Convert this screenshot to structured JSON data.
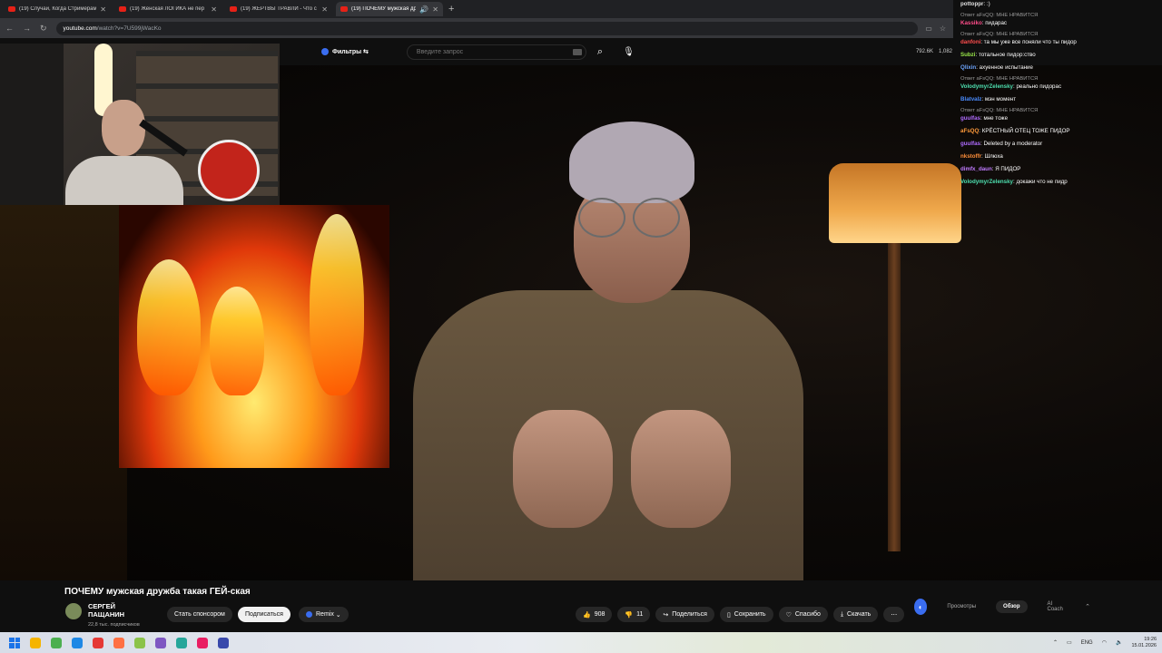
{
  "browser": {
    "tabs": [
      {
        "title": "(19) Случаи, Когда Стримерам",
        "active": false
      },
      {
        "title": "(19) Женская ЛОГИКА не пер",
        "active": false
      },
      {
        "title": "(19) ЖЕРТВЫ ТРАВЛИ - Что с",
        "active": false
      },
      {
        "title": "(19) ПОЧЕМУ мужская др",
        "active": true
      }
    ],
    "new_tab_glyph": "+",
    "url_host": "youtube.com",
    "url_path": "/watch?v=7U599jWacKo"
  },
  "youtube": {
    "filters_label": "Фильтры",
    "search_placeholder": "Введите запрос",
    "stats": [
      "792.6K",
      "1,082"
    ],
    "video_title": "ПОЧЕМУ мужская дружба такая ГЕЙ-ская",
    "channel_name": "СЕРГЕЙ ПАЩАНИН",
    "subscribers": "22,8 тыс. подписчиков",
    "sponsor_label": "Стать спонсором",
    "subscribe_label": "Подписаться",
    "remix_label": "Remix",
    "likes": "908",
    "dislikes": "11",
    "share_label": "Поделиться",
    "save_label": "Сохранить",
    "thanks_label": "Спасибо",
    "download_label": "Скачать",
    "more_glyph": "⋯"
  },
  "side_panel": {
    "tabs": [
      "Просмотры",
      "Обзор",
      "AI Coach"
    ],
    "active_tab": "Обзор"
  },
  "chat": [
    {
      "nick": "pottoppr",
      "text": ":)",
      "color": "#e0e0e0",
      "reply": ""
    },
    {
      "nick": "Kassiko",
      "text": "пидарас",
      "color": "#ff4d8a",
      "reply": "Ответ aFsQQ: МНЕ НРАВИТСЯ"
    },
    {
      "nick": "danfoni",
      "text": "та мы уже все поняли что ты пидор",
      "color": "#ff4d4d",
      "reply": "Ответ aFsQQ: МНЕ НРАВИТСЯ"
    },
    {
      "nick": "Subzi",
      "text": "тотальное пидор:ство",
      "color": "#9bea4a",
      "reply": ""
    },
    {
      "nick": "Qlixin",
      "text": "ахуенное испытание",
      "color": "#6fa8ff",
      "reply": ""
    },
    {
      "nick": "VolodymyrZelensky",
      "text": "реально пидорас",
      "color": "#4ee0b0",
      "reply": "Ответ aFsQQ: МНЕ НРАВИТСЯ"
    },
    {
      "nick": "Blatvalz",
      "text": "мэн момент",
      "color": "#4a8cff",
      "reply": ""
    },
    {
      "nick": "guulfas",
      "text": "мне тоже",
      "color": "#b06cff",
      "reply": "Ответ aFsQQ: МНЕ НРАВИТСЯ"
    },
    {
      "nick": "aFsQQ",
      "text": "КРЁСТНЫЙ ОТЕЦ ТОЖЕ ПИДОР",
      "color": "#ff9a3a",
      "reply": ""
    },
    {
      "nick": "guulfas",
      "text": "Deleted by a moderator",
      "color": "#b06cff",
      "reply": ""
    },
    {
      "nick": "nkstoffr",
      "text": "Шлюха",
      "color": "#ff8f3a",
      "reply": ""
    },
    {
      "nick": "dimfx_daun",
      "text": "Я ПИДОР",
      "color": "#c07bff",
      "reply": ""
    },
    {
      "nick": "VolodymyrZelensky",
      "text": "докажи что не пидр",
      "color": "#4ee0b0",
      "reply": ""
    }
  ],
  "taskbar": {
    "icons": [
      "#f5b400",
      "#4caf50",
      "#1e88e5",
      "#e53935",
      "#ff7043",
      "#8bc34a",
      "#7e57c2",
      "#26a69a",
      "#e91e63",
      "#3949ab"
    ],
    "lang": "ENG",
    "time": "19:26",
    "date": "15.01.2026"
  }
}
